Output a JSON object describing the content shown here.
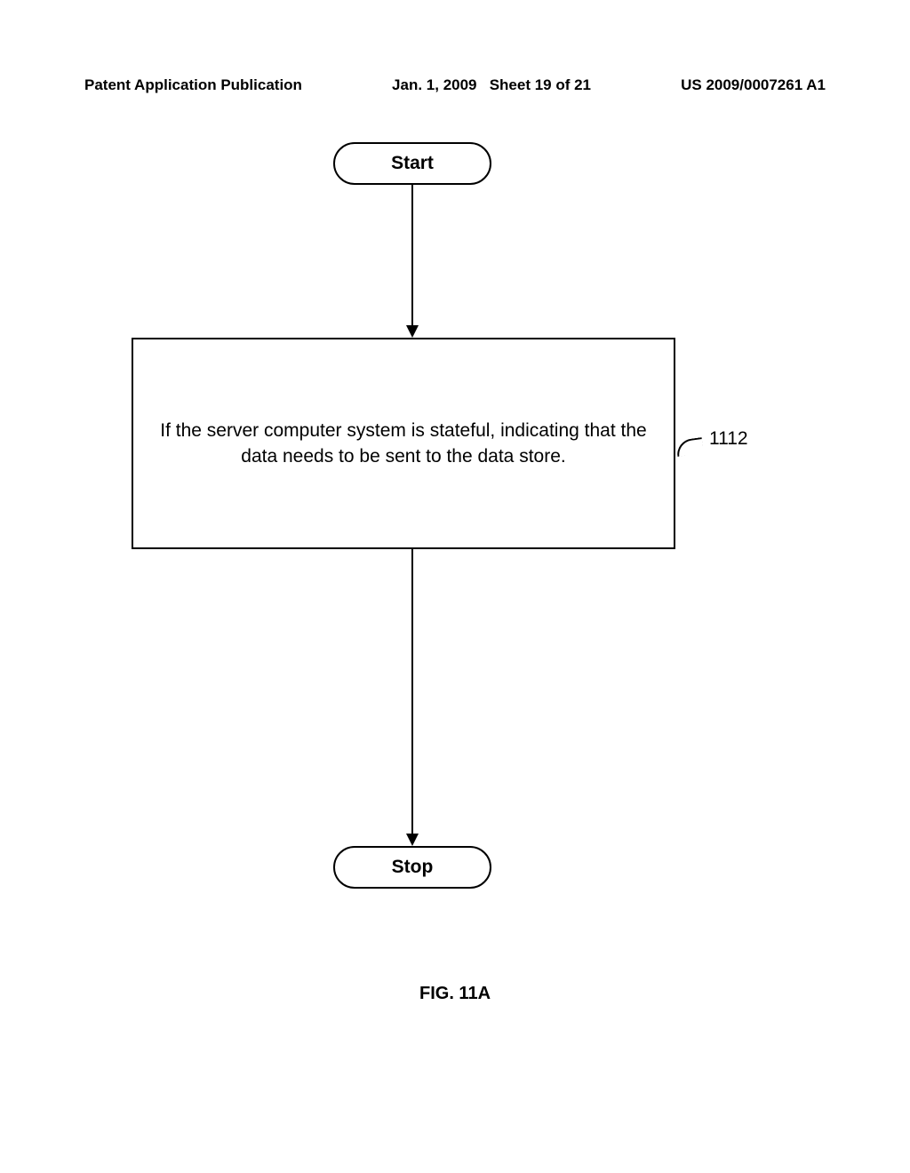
{
  "header": {
    "left": "Patent Application Publication",
    "date": "Jan. 1, 2009",
    "sheet": "Sheet 19 of 21",
    "pubnum": "US 2009/0007261 A1"
  },
  "flowchart": {
    "start_label": "Start",
    "stop_label": "Stop",
    "process_text": "If the server computer system is stateful, indicating that the data needs to be sent to the data store.",
    "ref_number": "1112"
  },
  "figure_label": "FIG. 11A"
}
